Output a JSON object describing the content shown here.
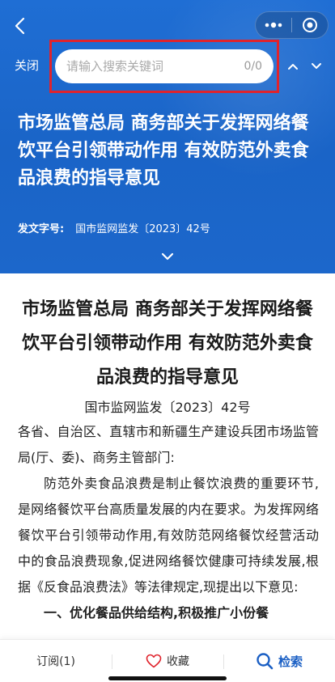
{
  "header": {
    "close_label": "关闭",
    "title": "市场监管总局 商务部关于发挥网络餐饮平台引领带动作用 有效防范外卖食品浪费的指导意见",
    "doc_no_label": "发文字号:",
    "doc_no_value": "国市监网监发〔2023〕42号"
  },
  "search": {
    "placeholder": "请输入搜索关键词",
    "value": "",
    "count": "0/0"
  },
  "article": {
    "title": "市场监管总局 商务部关于发挥网络餐饮平台引领带动作用 有效防范外卖食品浪费的指导意见",
    "doc_no": "国市监网监发〔2023〕42号",
    "addressee": "各省、自治区、直辖市和新疆生产建设兵团市场监管局(厅、委)、商务主管部门:",
    "paragraph1": "防范外卖食品浪费是制止餐饮浪费的重要环节,是网络餐饮平台高质量发展的内在要求。为发挥网络餐饮平台引领带动作用,有效防范网络餐饮经营活动中的食品浪费现象,促进网络餐饮健康可持续发展,根据《反食品浪费法》等法律规定,现提出以下意见:",
    "section1_partial": "一、优化餐品供给结构,积极推广小份餐"
  },
  "bottom_bar": {
    "subscribe_label": "订阅(1)",
    "favorite_label": "收藏",
    "search_label": "检索"
  },
  "colors": {
    "header_blue": "#1c67cb",
    "highlight_red": "#e0232c",
    "accent_blue": "#1a5fc4"
  }
}
